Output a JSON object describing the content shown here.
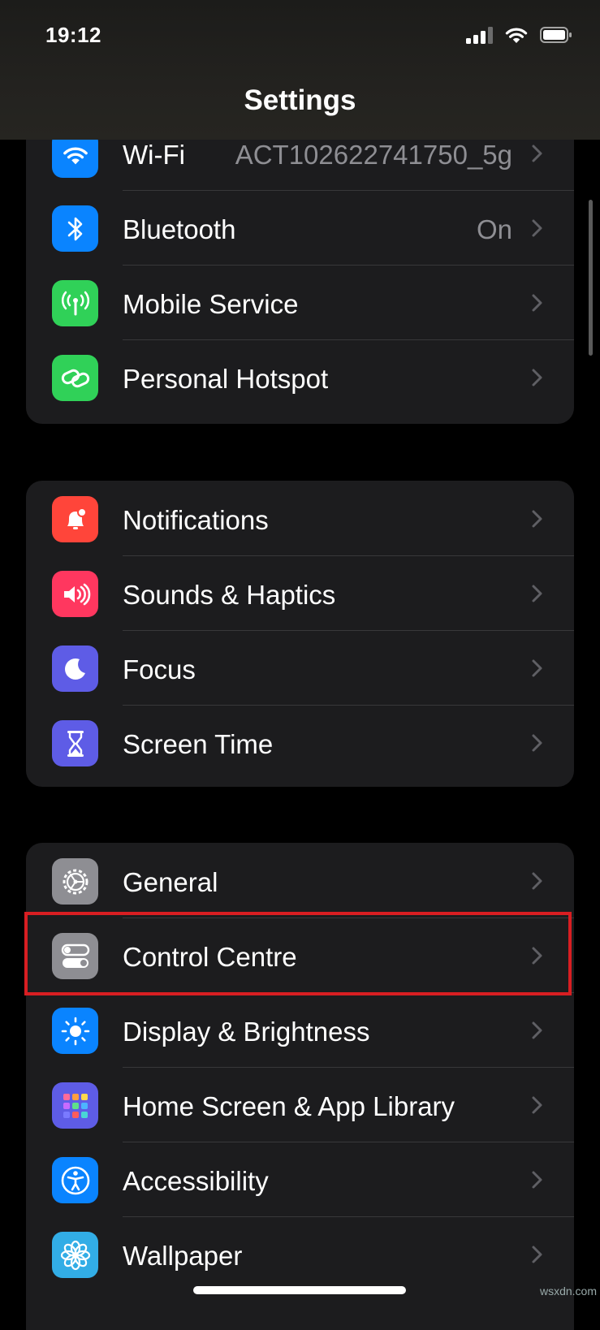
{
  "status_bar": {
    "time": "19:12",
    "signal_icon": "cellular-signal-icon",
    "wifi_icon": "wifi-icon",
    "battery_icon": "battery-icon"
  },
  "header": {
    "title": "Settings"
  },
  "groups": [
    {
      "items": [
        {
          "label": "Wi-Fi",
          "value": "ACT102622741750_5g",
          "icon": "wifi-icon",
          "color": "#0a84ff"
        },
        {
          "label": "Bluetooth",
          "value": "On",
          "icon": "bluetooth-icon",
          "color": "#0a84ff"
        },
        {
          "label": "Mobile Service",
          "value": "",
          "icon": "antenna-icon",
          "color": "#30d158"
        },
        {
          "label": "Personal Hotspot",
          "value": "",
          "icon": "hotspot-link-icon",
          "color": "#30d158"
        }
      ]
    },
    {
      "items": [
        {
          "label": "Notifications",
          "value": "",
          "icon": "notification-bell-icon",
          "color": "#ff453a"
        },
        {
          "label": "Sounds & Haptics",
          "value": "",
          "icon": "speaker-icon",
          "color": "#ff375f"
        },
        {
          "label": "Focus",
          "value": "",
          "icon": "moon-icon",
          "color": "#5e5ce6"
        },
        {
          "label": "Screen Time",
          "value": "",
          "icon": "hourglass-icon",
          "color": "#5e5ce6"
        }
      ]
    },
    {
      "items": [
        {
          "label": "General",
          "value": "",
          "icon": "gear-icon",
          "color": "#8e8e93"
        },
        {
          "label": "Control Centre",
          "value": "",
          "icon": "toggles-icon",
          "color": "#8e8e93"
        },
        {
          "label": "Display & Brightness",
          "value": "",
          "icon": "sun-icon",
          "color": "#0a84ff"
        },
        {
          "label": "Home Screen & App Library",
          "value": "",
          "icon": "app-grid-icon",
          "color": "#5e5ce6"
        },
        {
          "label": "Accessibility",
          "value": "",
          "icon": "accessibility-icon",
          "color": "#0a84ff"
        },
        {
          "label": "Wallpaper",
          "value": "",
          "icon": "flower-icon",
          "color": "#32ade6"
        }
      ]
    }
  ],
  "highlight_color": "#d81e22",
  "watermark": "wsxdn.com"
}
